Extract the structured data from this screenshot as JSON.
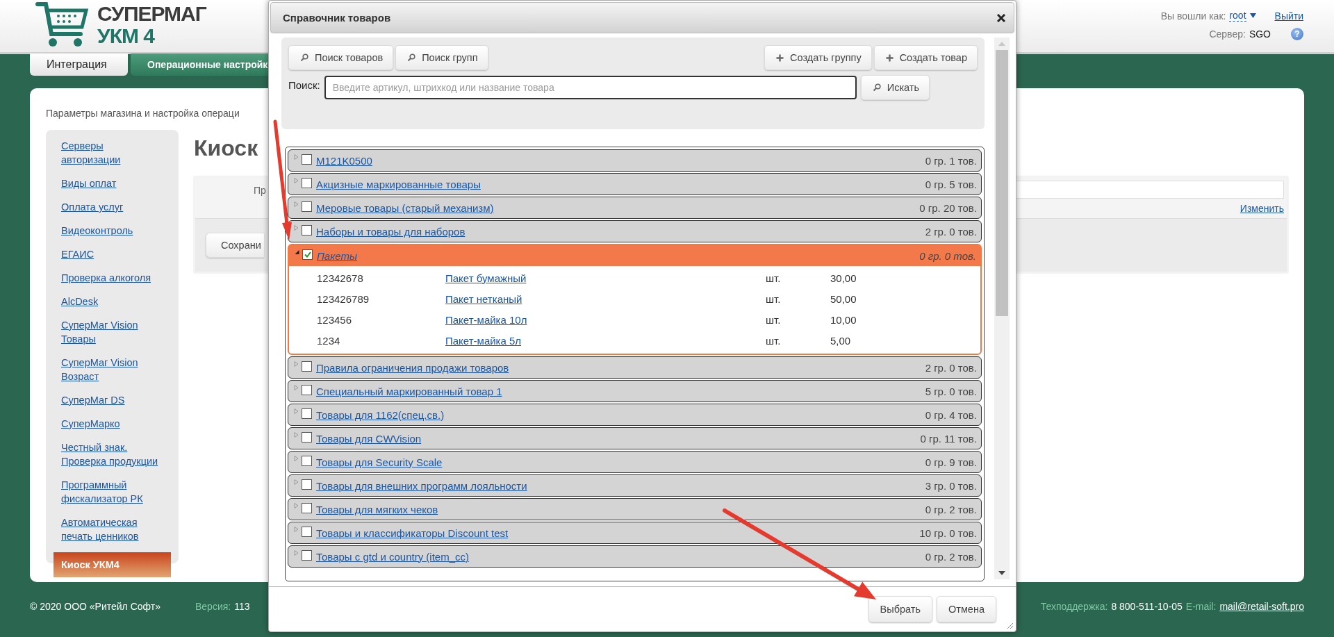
{
  "header": {
    "brand_top": "СУПЕРМАГ",
    "brand_bottom": "УКМ 4",
    "login_label": "Вы вошли как:",
    "user": "root",
    "logout": "Выйти",
    "server_label": "Сервер:",
    "server": "SGO",
    "help": "?"
  },
  "tabs": [
    {
      "label": "Интеграция",
      "selected": true
    },
    {
      "label": "Операционные настройк",
      "selected": false
    }
  ],
  "page": {
    "subtitle": "Параметры магазина и настройка операци",
    "heading": "Киоск",
    "field_label": "Пр",
    "change_link": "Изменить",
    "save_button": "Сохрани"
  },
  "sidebar": {
    "items": [
      {
        "label": "Серверы авторизации",
        "selected": false
      },
      {
        "label": "Виды оплат",
        "selected": false
      },
      {
        "label": "Оплата услуг",
        "selected": false
      },
      {
        "label": "Видеоконтроль",
        "selected": false
      },
      {
        "label": "ЕГАИС",
        "selected": false
      },
      {
        "label": "Проверка алкоголя",
        "selected": false
      },
      {
        "label": "AlcDesk",
        "selected": false
      },
      {
        "label": "СуперМаг Vision Товары",
        "selected": false
      },
      {
        "label": "СуперМаг Vision Возраст",
        "selected": false
      },
      {
        "label": "СуперМаг DS",
        "selected": false
      },
      {
        "label": "СуперМарко",
        "selected": false
      },
      {
        "label": "Честный знак. Проверка продукции",
        "selected": false
      },
      {
        "label": "Программный фискализатор РК",
        "selected": false
      },
      {
        "label": "Автоматическая печать ценников",
        "selected": false
      },
      {
        "label": "Киоск УКМ4",
        "selected": true
      }
    ]
  },
  "dialog": {
    "title": "Справочник товаров",
    "toolbar": [
      {
        "label": "Поиск товаров",
        "kind": "search"
      },
      {
        "label": "Поиск групп",
        "kind": "search"
      },
      {
        "label": "Создать группу",
        "kind": "create"
      },
      {
        "label": "Создать товар",
        "kind": "create"
      }
    ],
    "search": {
      "label": "Поиск:",
      "placeholder": "Введите артикул, штрихкод или название товара",
      "button": "Искать"
    },
    "groups": [
      {
        "name": "M121K0500",
        "count": "0 гр. 1 тов.",
        "checked": false,
        "expanded": false,
        "selected": false
      },
      {
        "name": "Акцизные маркированные товары",
        "count": "0 гр. 5 тов.",
        "checked": false,
        "expanded": false,
        "selected": false
      },
      {
        "name": "Меровые товары (старый механизм)",
        "count": "0 гр. 20 тов.",
        "checked": false,
        "expanded": false,
        "selected": false
      },
      {
        "name": "Наборы и товары для наборов",
        "count": "2 гр. 0 тов.",
        "checked": false,
        "expanded": false,
        "selected": false
      },
      {
        "name": "Пакеты",
        "count": "0 гр. 0 тов.",
        "checked": true,
        "expanded": true,
        "selected": true,
        "items": [
          {
            "code": "12342678",
            "name": "Пакет бумажный",
            "unit": "шт.",
            "price": "30,00"
          },
          {
            "code": "123426789",
            "name": "Пакет нетканый",
            "unit": "шт.",
            "price": "50,00"
          },
          {
            "code": "123456",
            "name": "Пакет-майка 10л",
            "unit": "шт.",
            "price": "10,00"
          },
          {
            "code": "1234",
            "name": "Пакет-майка 5л",
            "unit": "шт.",
            "price": "5,00"
          }
        ]
      },
      {
        "name": "Правила ограничения продажи товаров",
        "count": "2 гр. 0 тов.",
        "checked": false,
        "expanded": false,
        "selected": false
      },
      {
        "name": "Специальный маркированный товар 1",
        "count": "5 гр. 0 тов.",
        "checked": false,
        "expanded": false,
        "selected": false
      },
      {
        "name": "Товары для 1162(спец.св.)",
        "count": "0 гр. 4 тов.",
        "checked": false,
        "expanded": false,
        "selected": false
      },
      {
        "name": "Товары для CWVision",
        "count": "0 гр. 11 тов.",
        "checked": false,
        "expanded": false,
        "selected": false
      },
      {
        "name": "Товары для Security Scale",
        "count": "0 гр. 9 тов.",
        "checked": false,
        "expanded": false,
        "selected": false
      },
      {
        "name": "Товары для внешних программ лояльности",
        "count": "3 гр. 0 тов.",
        "checked": false,
        "expanded": false,
        "selected": false
      },
      {
        "name": "Товары для мягких чеков",
        "count": "0 гр. 2 тов.",
        "checked": false,
        "expanded": false,
        "selected": false
      },
      {
        "name": "Товары и классификаторы Discount test",
        "count": "10 гр. 0 тов.",
        "checked": false,
        "expanded": false,
        "selected": false
      },
      {
        "name": "Товары с gtd и country (item_cc)",
        "count": "0 гр. 2 тов.",
        "checked": false,
        "expanded": false,
        "selected": false
      }
    ],
    "buttons": [
      {
        "label": "Выбрать"
      },
      {
        "label": "Отмена"
      }
    ]
  },
  "footer": {
    "copyright": "© 2020 ООО «Ритейл Софт»",
    "version_label": "Версия:",
    "version": "113",
    "support_label": "Техподдержка:",
    "support_phone": "8 800-511-10-05",
    "email_label": "E-mail:",
    "email": "mail@retail-soft.pro"
  }
}
